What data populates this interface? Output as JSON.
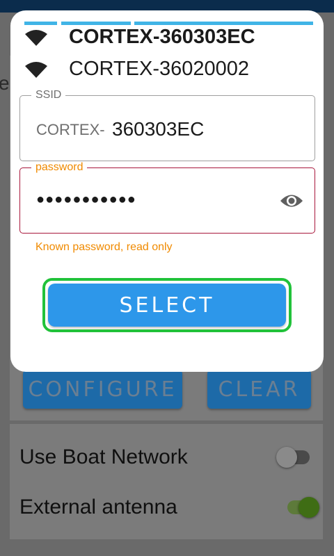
{
  "background": {
    "peek_text": "el",
    "buttons": {
      "configure": "CONFIGURE",
      "clear": "CLEAR"
    },
    "settings": [
      {
        "label": "Use Boat Network",
        "enabled": false
      },
      {
        "label": "External antenna",
        "enabled": true
      }
    ]
  },
  "dialog": {
    "networks": [
      {
        "name": "CORTEX-360303EC",
        "selected": true,
        "icon": "wifi-icon"
      },
      {
        "name": "CORTEX-36020002",
        "selected": false,
        "icon": "wifi-icon"
      }
    ],
    "ssid": {
      "label": "SSID",
      "prefix": "CORTEX-",
      "value": "360303EC"
    },
    "password": {
      "label": "password",
      "value": "●●●●●●●●●●●",
      "helper": "Known password, read only",
      "toggle_icon": "eye-icon"
    },
    "select_label": "SELECT"
  },
  "colors": {
    "accent": "#2d97ea",
    "highlight": "#21c23a",
    "error_border": "#a8163a",
    "warning_text": "#f08a00"
  }
}
